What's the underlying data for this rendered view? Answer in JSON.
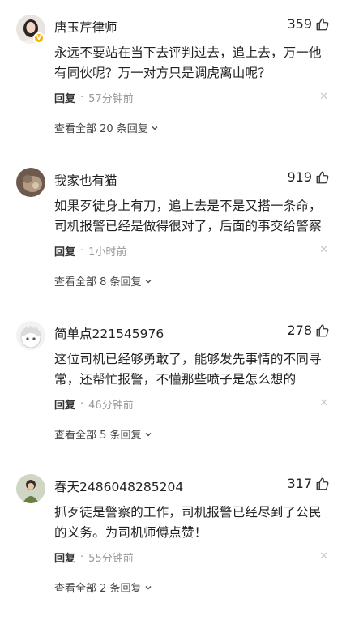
{
  "comments": [
    {
      "username": "唐玉芹律师",
      "likes": "359",
      "text": "永远不要站在当下去评判过去，追上去，万一他有同伙呢？万一对方只是调虎离山呢？",
      "reply_label": "回复",
      "dot": "·",
      "time": "57分钟前",
      "view_replies": "查看全部 20 条回复",
      "verified": true
    },
    {
      "username": "我家也有猫",
      "likes": "919",
      "text": "如果歹徒身上有刀，追上去是不是又搭一条命，司机报警已经是做得很对了，后面的事交给警察",
      "reply_label": "回复",
      "dot": "·",
      "time": "1小时前",
      "view_replies": "查看全部 8 条回复",
      "verified": false
    },
    {
      "username": "简单点221545976",
      "likes": "278",
      "text": "这位司机已经够勇敢了，能够发先事情的不同寻常，还帮忙报警，不懂那些喷子是怎么想的",
      "reply_label": "回复",
      "dot": "·",
      "time": "46分钟前",
      "view_replies": "查看全部 5 条回复",
      "verified": false
    },
    {
      "username": "春天2486048285204",
      "likes": "317",
      "text": "抓歹徒是警察的工作，司机报警已经尽到了公民的义务。为司机师傅点赞！",
      "reply_label": "回复",
      "dot": "·",
      "time": "55分钟前",
      "view_replies": "查看全部 2 条回复",
      "verified": false
    }
  ],
  "icons": {
    "like": "thumbs-up-icon",
    "close": "close-icon",
    "expand": "chevron-down-icon"
  },
  "colors": {
    "text": "#222222",
    "muted": "#999999",
    "badge": "#f5b400"
  }
}
